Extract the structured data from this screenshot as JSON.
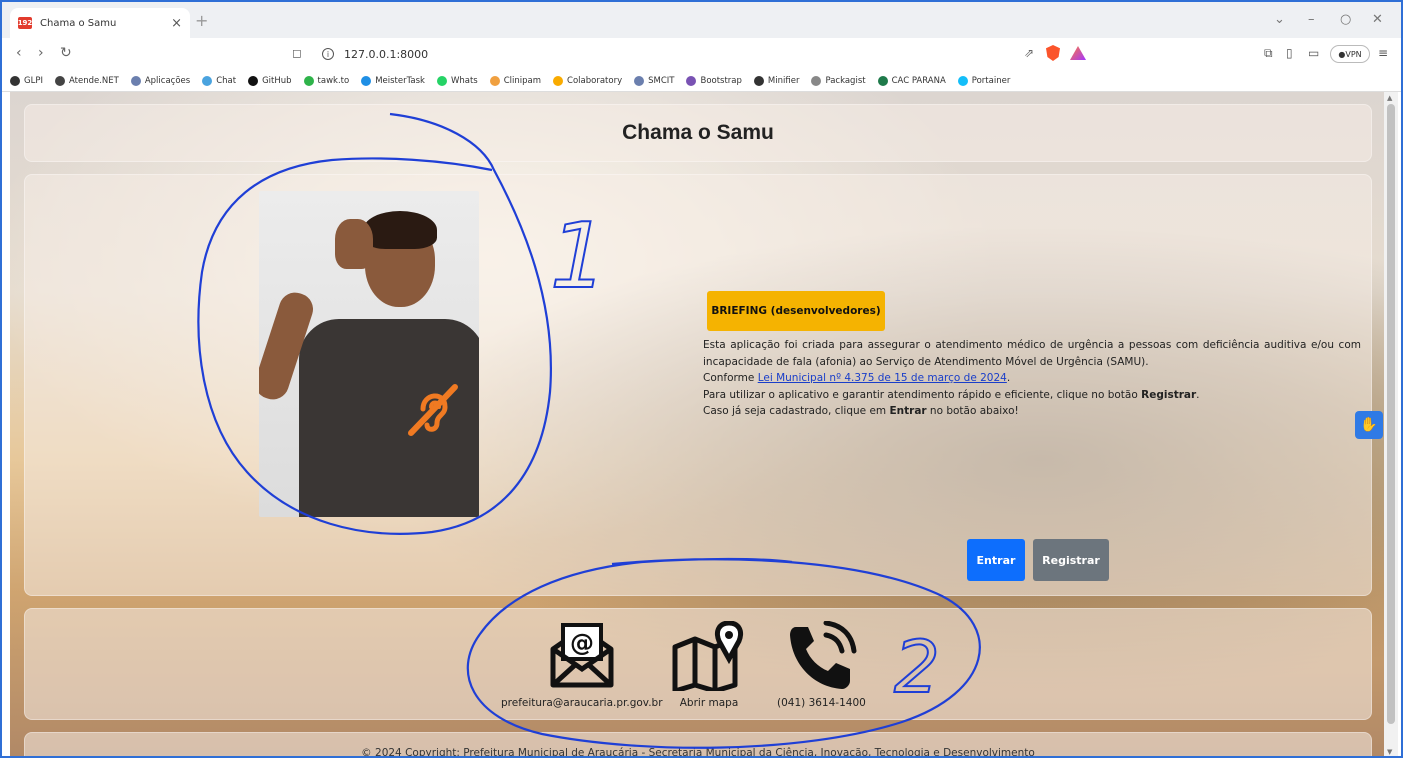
{
  "browser": {
    "tab_title": "Chama o Samu",
    "favicon_text": "192",
    "url": "127.0.0.1:8000",
    "vpn_label": "VPN",
    "bookmarks": [
      {
        "label": "GLPI",
        "color": "#333333"
      },
      {
        "label": "Atende.NET",
        "color": "#444444"
      },
      {
        "label": "Aplicações",
        "color": "#6b7fae"
      },
      {
        "label": "Chat",
        "color": "#4aa3df"
      },
      {
        "label": "GitHub",
        "color": "#111111"
      },
      {
        "label": "tawk.to",
        "color": "#2fb34a"
      },
      {
        "label": "MeisterTask",
        "color": "#1f8fe5"
      },
      {
        "label": "Whats",
        "color": "#25d366"
      },
      {
        "label": "Clinipam",
        "color": "#f0a040"
      },
      {
        "label": "Colaboratory",
        "color": "#f9ab00"
      },
      {
        "label": "SMCIT",
        "color": "#6b7fae"
      },
      {
        "label": "Bootstrap",
        "color": "#7952b3"
      },
      {
        "label": "Minifier",
        "color": "#333333"
      },
      {
        "label": "Packagist",
        "color": "#888888"
      },
      {
        "label": "CAC PARANA",
        "color": "#1e7a4a"
      },
      {
        "label": "Portainer",
        "color": "#13bef9"
      }
    ]
  },
  "header": {
    "title": "Chama o Samu"
  },
  "briefing": {
    "button_label": "BRIEFING (desenvolvedores)",
    "paragraph": "Esta aplicação foi criada para assegurar o atendimento médico de urgência a pessoas com deficiência auditiva e/ou com incapacidade de fala (afonia) ao Serviço de Atendimento Móvel de Urgência (SAMU).",
    "conforme_prefix": "Conforme ",
    "law_link": "Lei Municipal nº 4.375 de 15 de março de 2024",
    "conforme_suffix": ".",
    "use_prefix": "Para utilizar o aplicativo e garantir atendimento rápido e eficiente, clique no botão ",
    "use_bold": "Registrar",
    "use_suffix": ".",
    "login_prefix": "Caso já seja cadastrado, clique em ",
    "login_bold": "Entrar",
    "login_suffix": " no botão abaixo!"
  },
  "actions": {
    "login_label": "Entrar",
    "register_label": "Registrar"
  },
  "contacts": {
    "email": "prefeitura@araucaria.pr.gov.br",
    "map": "Abrir mapa",
    "phone": "(041) 3614-1400"
  },
  "footer": {
    "text": "© 2024 Copyright: Prefeitura Municipal de Araucária - Secretaria Municipal da Ciência, Inovação, Tecnologia e Desenvolvimento"
  },
  "annotations": {
    "label_1": "1",
    "label_2": "2",
    "color": "#1f3fd6"
  },
  "colors": {
    "primary": "#0d6efd",
    "secondary": "#6c757d",
    "warning": "#f5b301"
  }
}
